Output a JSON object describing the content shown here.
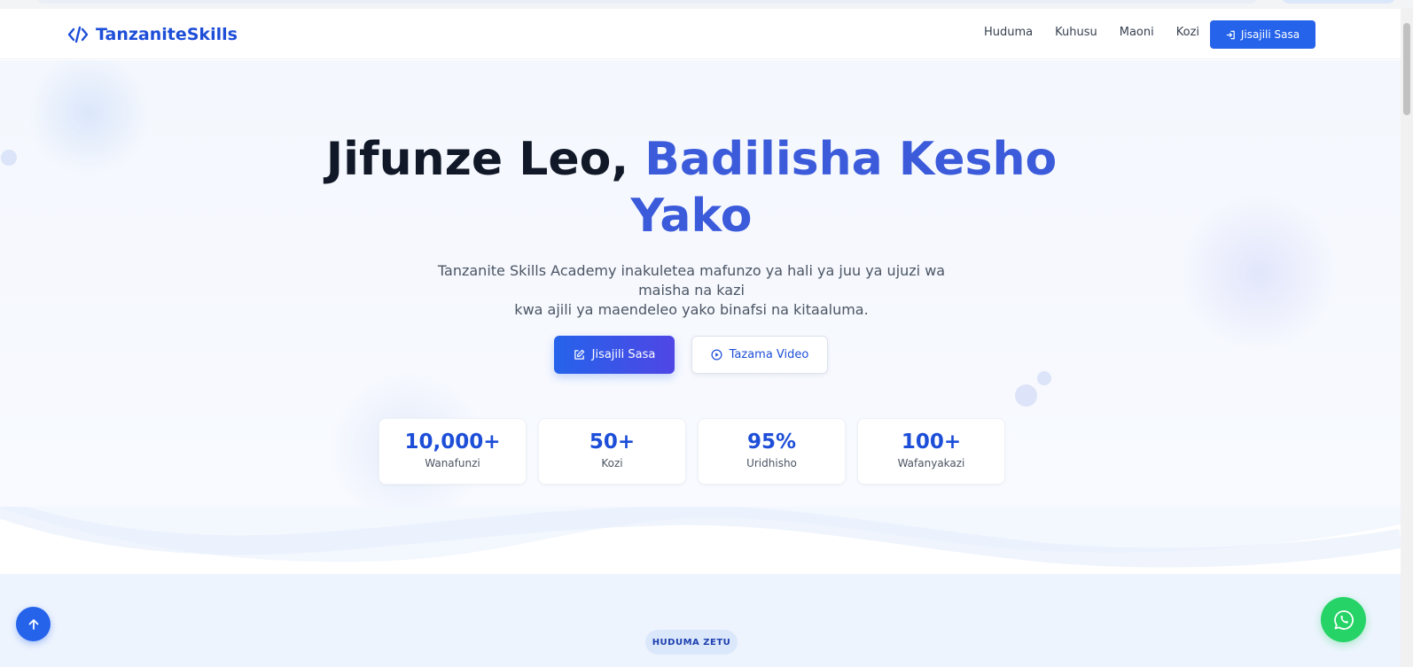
{
  "brand": {
    "name": "TanzaniteSkills",
    "icon": "code-icon",
    "color": "#1d4ed8"
  },
  "nav": {
    "links": [
      "Huduma",
      "Kuhusu",
      "Maoni",
      "Kozi"
    ],
    "cta_label": "Jisajili Sasa",
    "cta_icon": "sign-in-icon"
  },
  "hero": {
    "title_plain": "Jifunze Leo, ",
    "title_accent_1": "Badilisha Kesho",
    "title_accent_2": "Yako",
    "subtitle_line1": "Tanzanite Skills Academy inakuletea mafunzo ya hali ya juu ya ujuzi wa maisha na kazi",
    "subtitle_line2": "kwa ajili ya maendeleo yako binafsi na kitaaluma.",
    "primary_button": {
      "label": "Jisajili Sasa",
      "icon": "edit-icon"
    },
    "secondary_button": {
      "label": "Tazama Video",
      "icon": "play-circle-icon"
    }
  },
  "stats": [
    {
      "value": "10,000+",
      "label": "Wanafunzi"
    },
    {
      "value": "50+",
      "label": "Kozi"
    },
    {
      "value": "95%",
      "label": "Uridhisho"
    },
    {
      "value": "100+",
      "label": "Wafanyakazi"
    }
  ],
  "services_section": {
    "badge": "HUDUMA ZETU"
  },
  "floating": {
    "back_to_top_icon": "arrow-up-icon",
    "chat_icon": "whatsapp-icon"
  },
  "colors": {
    "primary": "#2563eb",
    "accent": "#3b5bdb",
    "whatsapp": "#25d366"
  }
}
